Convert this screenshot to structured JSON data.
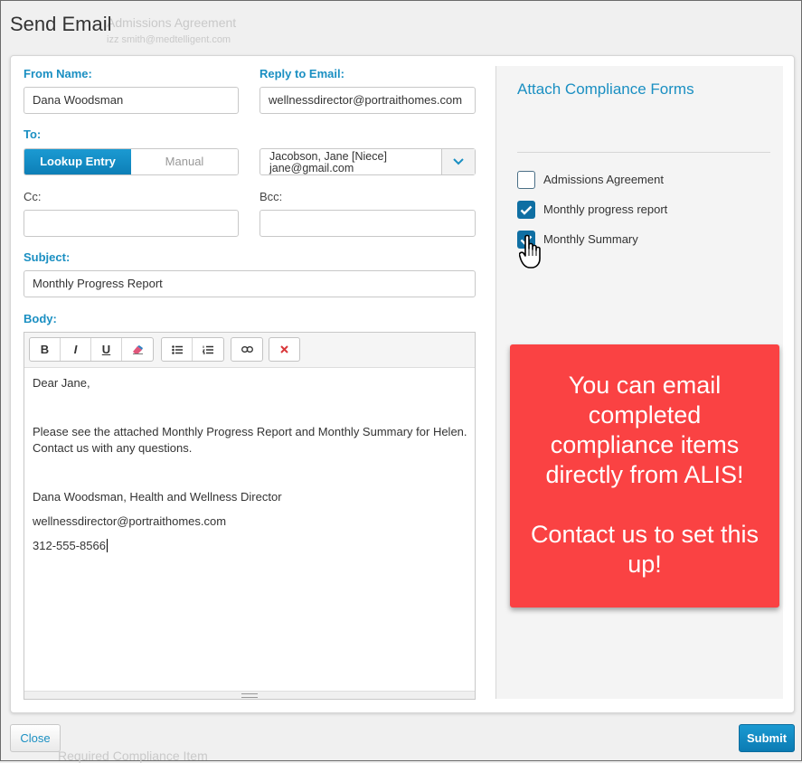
{
  "background": {
    "ghost_agreement": "Admissions Agreement",
    "ghost_email": "izz smith@medtelligent.com",
    "ghost_footer": "Required Compliance Item"
  },
  "dialog": {
    "title": "Send Email"
  },
  "form": {
    "from_name_label": "From Name:",
    "from_name_value": "Dana Woodsman",
    "reply_to_label": "Reply to Email:",
    "reply_to_value": "wellnessdirector@portraithomes.com",
    "to_label": "To:",
    "to_mode_lookup": "Lookup Entry",
    "to_mode_manual": "Manual",
    "to_selected_line1": "Jacobson, Jane [Niece]",
    "to_selected_line2": "jane@gmail.com",
    "cc_label": "Cc:",
    "cc_value": "",
    "bcc_label": "Bcc:",
    "bcc_value": "",
    "subject_label": "Subject:",
    "subject_value": "Monthly Progress Report",
    "body_label": "Body:"
  },
  "toolbar": {
    "bold": "B",
    "italic": "I",
    "underline": "U"
  },
  "body": {
    "greeting": "Dear Jane,",
    "para_line1": "Please see the attached Monthly Progress Report and Monthly Summary for Helen.",
    "para_line2": "Contact us with any questions.",
    "sig_name": "Dana Woodsman, Health and Wellness Director",
    "sig_email": "wellnessdirector@portraithomes.com",
    "sig_phone": "312-555-8566"
  },
  "compliance": {
    "title": "Attach Compliance Forms",
    "items": [
      {
        "label": "Admissions Agreement",
        "checked": false
      },
      {
        "label": "Monthly progress report",
        "checked": true
      },
      {
        "label": "Monthly Summary",
        "checked": true
      }
    ]
  },
  "promo": {
    "text1": "You can email completed compliance items directly from ALIS!",
    "text2": "Contact us to set this up!"
  },
  "footer": {
    "close": "Close",
    "submit": "Submit"
  },
  "colors": {
    "accent": "#1a8fc2",
    "promo": "#fa4243",
    "checkbox": "#0f6fa3"
  }
}
